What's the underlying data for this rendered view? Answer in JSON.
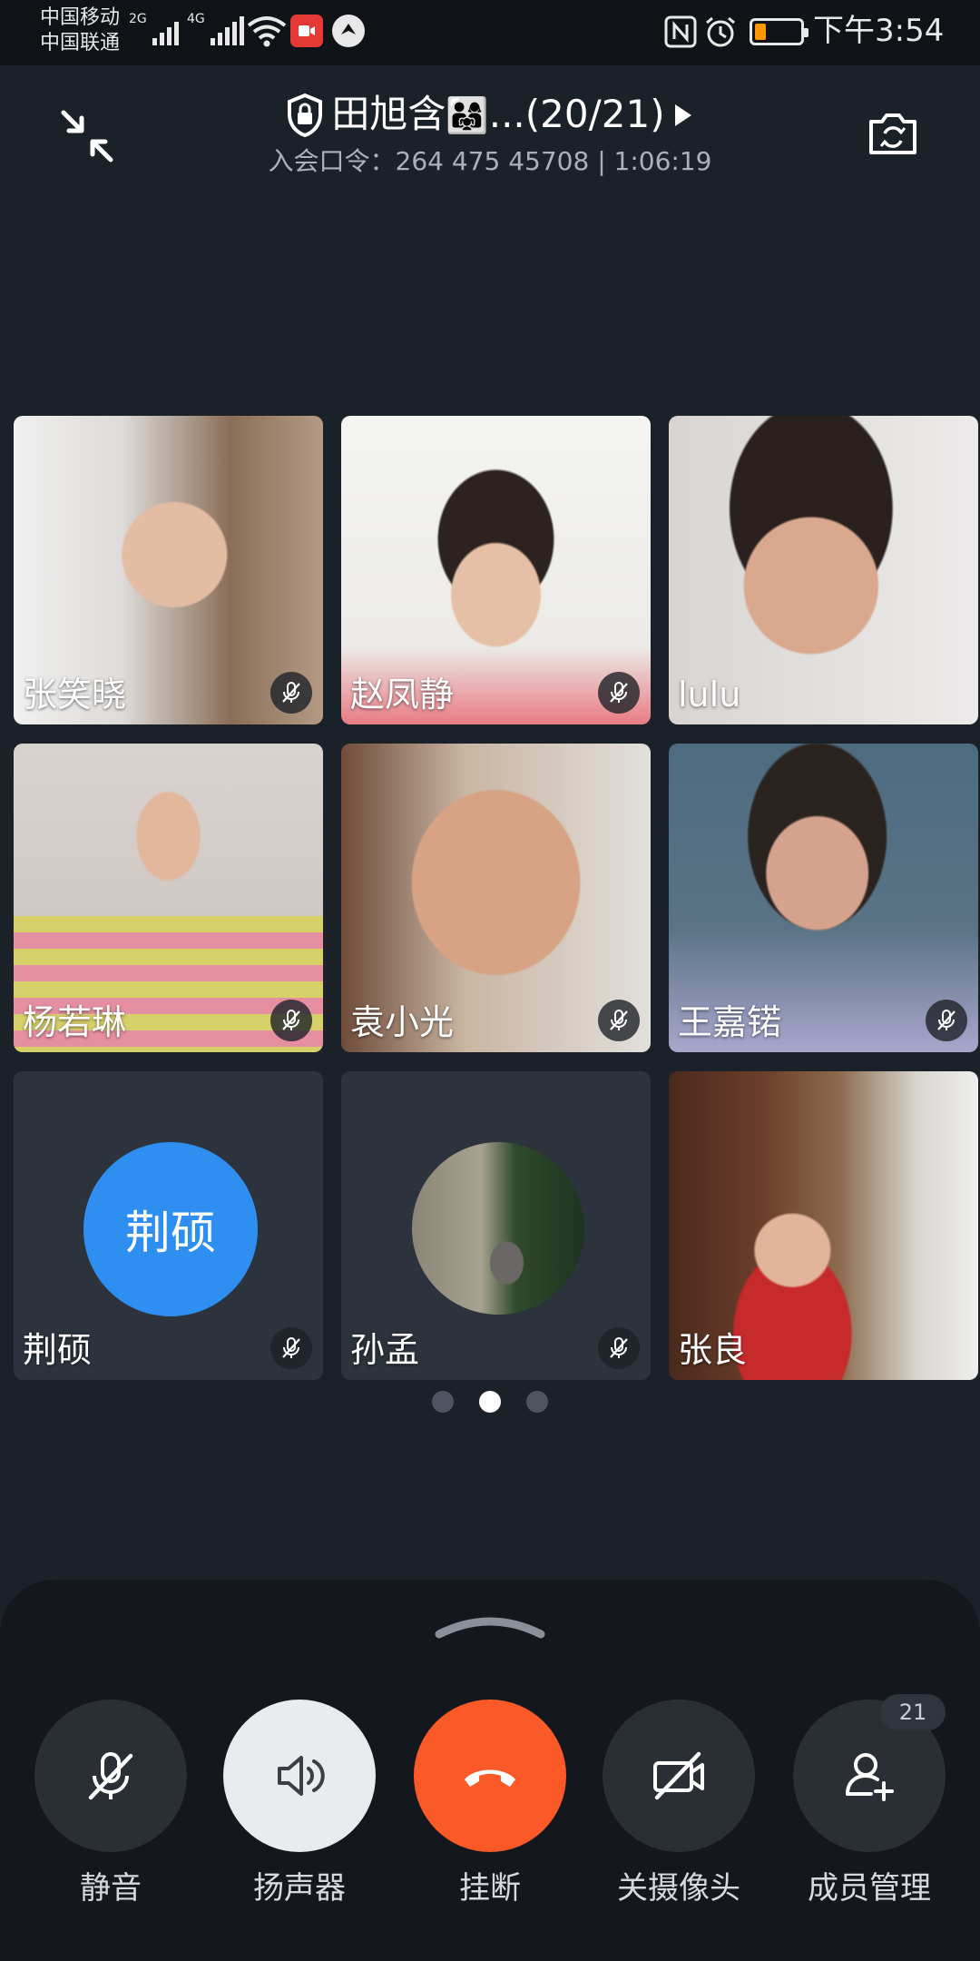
{
  "status_bar": {
    "carrier1": "中国移动",
    "carrier2": "中国联通",
    "sim1_network": "2G",
    "sim2_network": "4G",
    "clock": "下午3:54",
    "battery_level": 0.2,
    "battery_color": "#ff9800"
  },
  "header": {
    "title": "田旭含",
    "title_emoji": "👨‍👩‍👧",
    "title_suffix": "...(20/21)",
    "meeting_code_label": "入会口令：",
    "meeting_code": "264 475 45708",
    "separator": "|",
    "duration": "1:06:19"
  },
  "participants": [
    {
      "name": "张笑晓",
      "muted": true,
      "video": true
    },
    {
      "name": "赵凤静",
      "muted": true,
      "video": true
    },
    {
      "name": "lulu",
      "muted": false,
      "video": true
    },
    {
      "name": "杨若琳",
      "muted": true,
      "video": true
    },
    {
      "name": "袁小光",
      "muted": true,
      "video": true
    },
    {
      "name": "王嘉锘",
      "muted": true,
      "video": true
    },
    {
      "name": "荆硕",
      "avatar_text": "荆硕",
      "muted": true,
      "video": false
    },
    {
      "name": "孙孟",
      "muted": true,
      "video": false
    },
    {
      "name": "张良",
      "muted": false,
      "video": true
    }
  ],
  "pagination": {
    "pages": 3,
    "current": 2
  },
  "controls": [
    {
      "label": "静音",
      "icon": "mic-off-icon"
    },
    {
      "label": "扬声器",
      "icon": "speaker-icon"
    },
    {
      "label": "挂断",
      "icon": "hangup-icon"
    },
    {
      "label": "关摄像头",
      "icon": "camera-off-icon"
    },
    {
      "label": "成员管理",
      "icon": "add-member-icon"
    }
  ],
  "member_count": "21",
  "colors": {
    "background": "#1b2129",
    "hangup": "#fb5a28",
    "avatar": "#2e8ff0",
    "active_dot": "#ffffff"
  }
}
